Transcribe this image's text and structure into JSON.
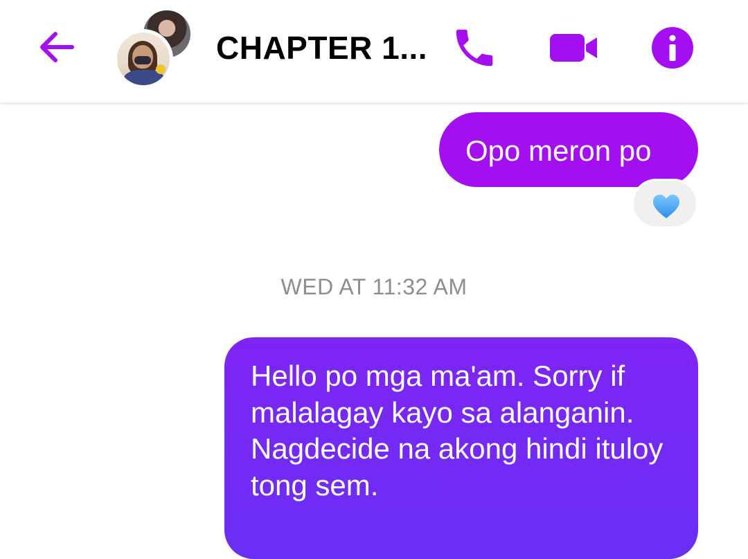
{
  "header": {
    "title": "CHAPTER 1...",
    "back_icon": "arrow-left-icon",
    "call_icon": "phone-icon",
    "video_icon": "video-camera-icon",
    "info_icon": "info-icon",
    "accent_color": "#a40ff1"
  },
  "messages": [
    {
      "type": "outgoing",
      "text": "Opo meron po",
      "reaction": "💙"
    },
    {
      "type": "timestamp",
      "text": "WED AT 11:32 AM"
    },
    {
      "type": "outgoing",
      "text": "Hello po mga ma'am. Sorry if malalagay kayo sa alanganin. Nagdecide na akong hindi ituloy tong sem."
    }
  ]
}
